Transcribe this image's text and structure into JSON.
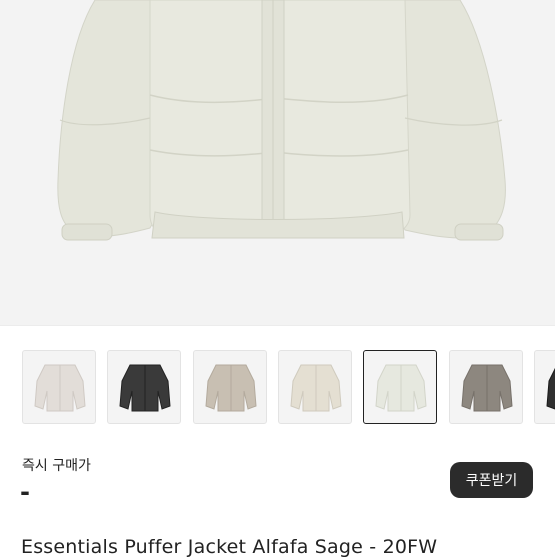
{
  "product": {
    "image_icon": "puffer-jacket-image",
    "colors": {
      "hero": "#e6e7dd",
      "selected_border": "#222222"
    }
  },
  "thumbnails": [
    {
      "name": "thumbnail-1",
      "color": "#e2ddd8",
      "selected": false
    },
    {
      "name": "thumbnail-2",
      "color": "#3a3a3a",
      "selected": false
    },
    {
      "name": "thumbnail-3",
      "color": "#c8bfb2",
      "selected": false
    },
    {
      "name": "thumbnail-4",
      "color": "#e4dfd2",
      "selected": false
    },
    {
      "name": "thumbnail-5",
      "color": "#e6e8df",
      "selected": true
    },
    {
      "name": "thumbnail-6",
      "color": "#8d877f",
      "selected": false
    },
    {
      "name": "thumbnail-7",
      "color": "#2f2f2f",
      "selected": false
    }
  ],
  "price": {
    "label": "즉시 구매가",
    "value": "-"
  },
  "coupon_button": "쿠폰받기",
  "title": "Essentials Puffer Jacket Alfafa Sage - 20FW"
}
